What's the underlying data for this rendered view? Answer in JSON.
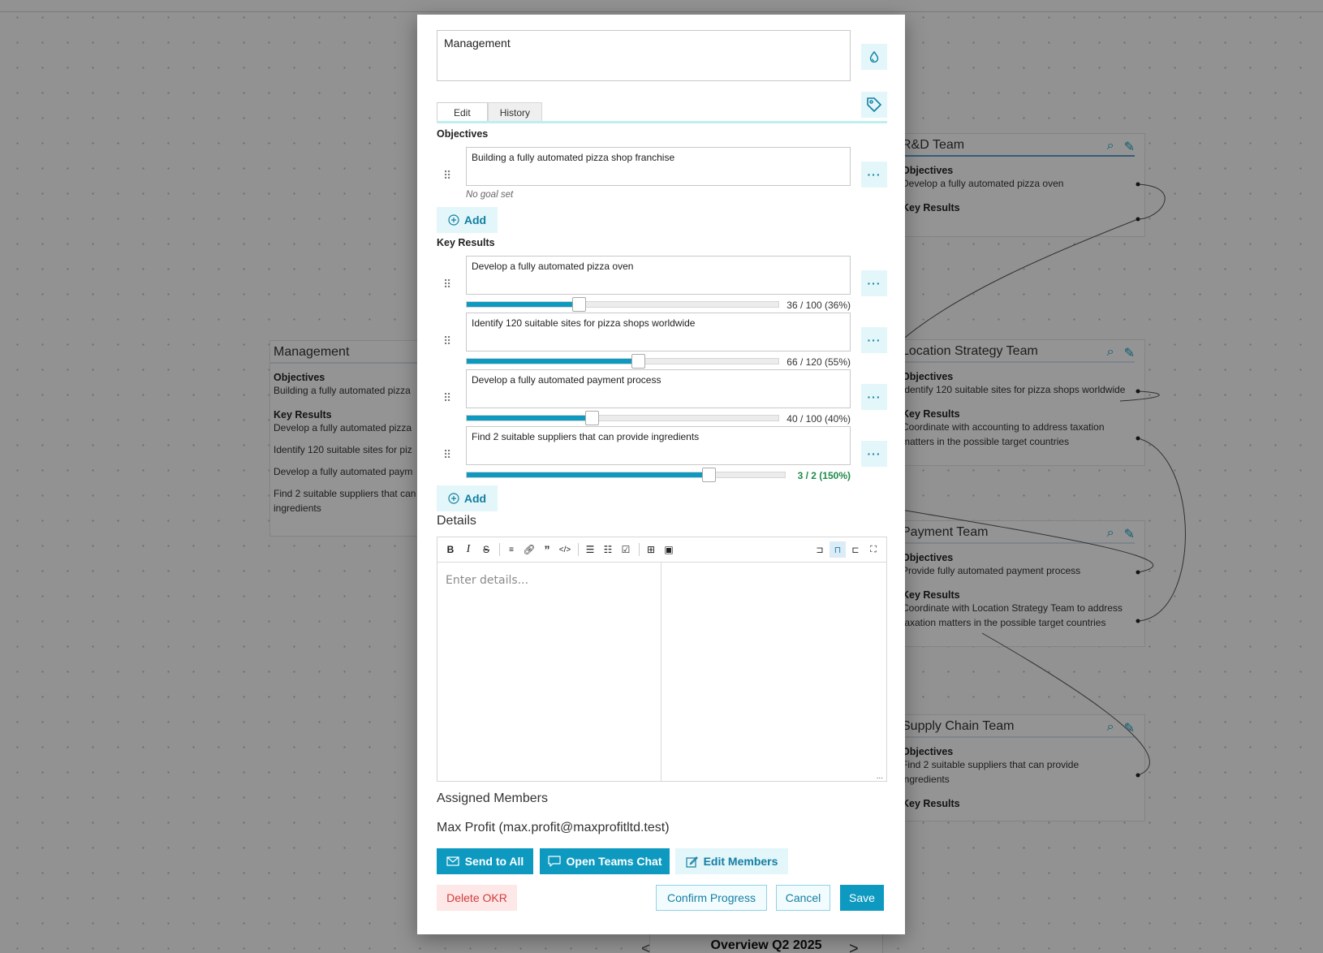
{
  "board": {
    "cards": [
      {
        "title": "Management",
        "objectives_label": "Objectives",
        "objectives": [
          "Building a fully automated pizza"
        ],
        "key_results_label": "Key Results",
        "key_results": [
          "Develop a fully automated pizza",
          "Identify 120 suitable sites for piz",
          "Develop a fully automated paym",
          "Find 2 suitable suppliers that can",
          "ingredients"
        ]
      },
      {
        "title": "R&D Team",
        "objectives_label": "Objectives",
        "objectives": [
          "Develop a fully automated pizza oven"
        ],
        "key_results_label": "Key Results",
        "key_results": []
      },
      {
        "title": "Location Strategy Team",
        "objectives_label": "Objectives",
        "objectives": [
          "Identify 120 suitable sites for pizza shops worldwide"
        ],
        "key_results_label": "Key Results",
        "key_results": [
          "Coordinate with accounting to address taxation",
          "matters in the possible target countries"
        ]
      },
      {
        "title": "Payment Team",
        "objectives_label": "Objectives",
        "objectives": [
          "Provide fully automated payment process"
        ],
        "key_results_label": "Key Results",
        "key_results": [
          "Coordinate with Location Strategy Team to address",
          "taxation matters in the possible target countries"
        ]
      },
      {
        "title": "Supply Chain Team",
        "objectives_label": "Objectives",
        "objectives": [
          "Find 2 suitable suppliers that can provide",
          "ingredients"
        ],
        "key_results_label": "Key Results",
        "key_results": []
      }
    ],
    "bottom_title": "Overview Q2 2025",
    "prev_icon": "<",
    "next_icon": ">"
  },
  "dialog": {
    "name_value": "Management",
    "color_icon": "droplet-icon",
    "tag_icon": "tag-icon",
    "tabs": [
      "Edit",
      "History"
    ],
    "active_tab": "Edit",
    "objectives_label": "Objectives",
    "objectives": [
      {
        "text": "Building a fully automated pizza shop franchise",
        "goal": "No goal set"
      }
    ],
    "add_label": "Add",
    "key_results_label": "Key Results",
    "key_results": [
      {
        "text": "Develop a fully automated pizza oven",
        "current": 36,
        "target": 100,
        "progress_text": "36 / 100 (36%)",
        "fraction": 0.36,
        "over": false
      },
      {
        "text": "Identify 120 suitable sites for pizza shops worldwide",
        "current": 66,
        "target": 120,
        "progress_text": "66 / 120 (55%)",
        "fraction": 0.55,
        "over": false
      },
      {
        "text": "Develop a fully automated payment process",
        "current": 40,
        "target": 100,
        "progress_text": "40 / 100 (40%)",
        "fraction": 0.4,
        "over": false
      },
      {
        "text": "Find 2 suitable suppliers that can provide ingredients",
        "current": 3,
        "target": 2,
        "progress_text": "3 / 2 (150%)",
        "fraction": 0.76,
        "over": true
      }
    ],
    "details_label": "Details",
    "details_placeholder": "Enter details...",
    "toolbar": [
      "bold",
      "italic",
      "strikethrough",
      "heading",
      "link",
      "quote",
      "code",
      "bullet-list",
      "numbered-list",
      "task-list",
      "table",
      "image",
      "preview-left",
      "split-view",
      "preview-right",
      "fullscreen"
    ],
    "resize_glyph": "...",
    "assigned_label": "Assigned Members",
    "member": "Max Profit (max.profit@maxprofitltd.test)",
    "buttons": {
      "send_all": "Send to All",
      "teams_chat": "Open Teams Chat",
      "edit_members": "Edit Members",
      "delete": "Delete OKR",
      "confirm": "Confirm Progress",
      "cancel": "Cancel",
      "save": "Save"
    },
    "more_glyph": "···"
  },
  "colors": {
    "accent": "#0e9ac0",
    "accent_light": "#e3f6fa",
    "danger": "#d33c3c",
    "success": "#1f8a4c"
  }
}
